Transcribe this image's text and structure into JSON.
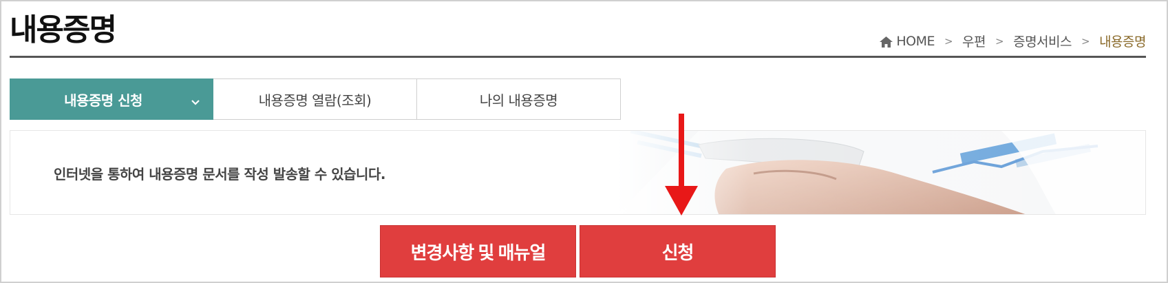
{
  "page": {
    "title": "내용증명"
  },
  "breadcrumb": {
    "home": "HOME",
    "level1": "우편",
    "level2": "증명서비스",
    "current": "내용증명",
    "separator": ">"
  },
  "tabs": [
    {
      "label": "내용증명 신청",
      "active": true,
      "icon": "chevron-down-icon"
    },
    {
      "label": "내용증명 열람(조회)",
      "active": false
    },
    {
      "label": "나의 내용증명",
      "active": false
    }
  ],
  "banner": {
    "text": "인터넷을 통하여 내용증명 문서를 작성 발송할 수 있습니다."
  },
  "buttons": {
    "manual_label": "변경사항 및 매뉴얼",
    "apply_label": "신청"
  },
  "colors": {
    "tab_active": "#4a9a96",
    "button_red": "#e03e3e",
    "breadcrumb_current": "#8a6a2a",
    "annotation_arrow": "#e81818"
  },
  "icons": [
    "home-icon",
    "chevron-down-icon",
    "annotation-arrow"
  ]
}
